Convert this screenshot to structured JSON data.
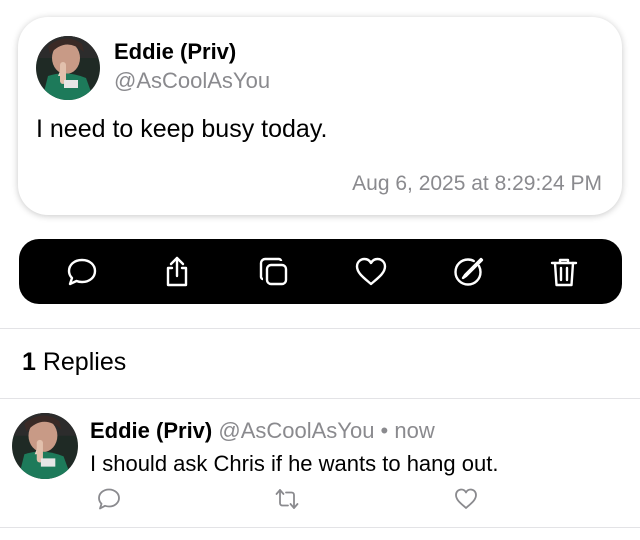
{
  "post": {
    "author_name": "Eddie (Priv)",
    "author_handle": "@AsCoolAsYou",
    "text": "I need to keep busy today.",
    "timestamp": "Aug 6, 2025 at 8:29:24 PM",
    "avatar": "profile-photo"
  },
  "actions": [
    {
      "icon": "reply-icon"
    },
    {
      "icon": "share-icon"
    },
    {
      "icon": "copy-icon"
    },
    {
      "icon": "heart-icon"
    },
    {
      "icon": "edit-icon"
    },
    {
      "icon": "trash-icon"
    }
  ],
  "replies_header": {
    "count": "1",
    "label": " Replies"
  },
  "replies": [
    {
      "author_name": "Eddie (Priv)",
      "author_handle": "@AsCoolAsYou",
      "separator": " • ",
      "time": "now",
      "text": "I should ask Chris if he wants to hang out.",
      "actions": [
        "reply-icon",
        "repost-icon",
        "heart-icon"
      ]
    }
  ],
  "colors": {
    "action_bar": "#000000",
    "secondary_text": "#8a8a8e",
    "divider": "#e3e3e6"
  }
}
